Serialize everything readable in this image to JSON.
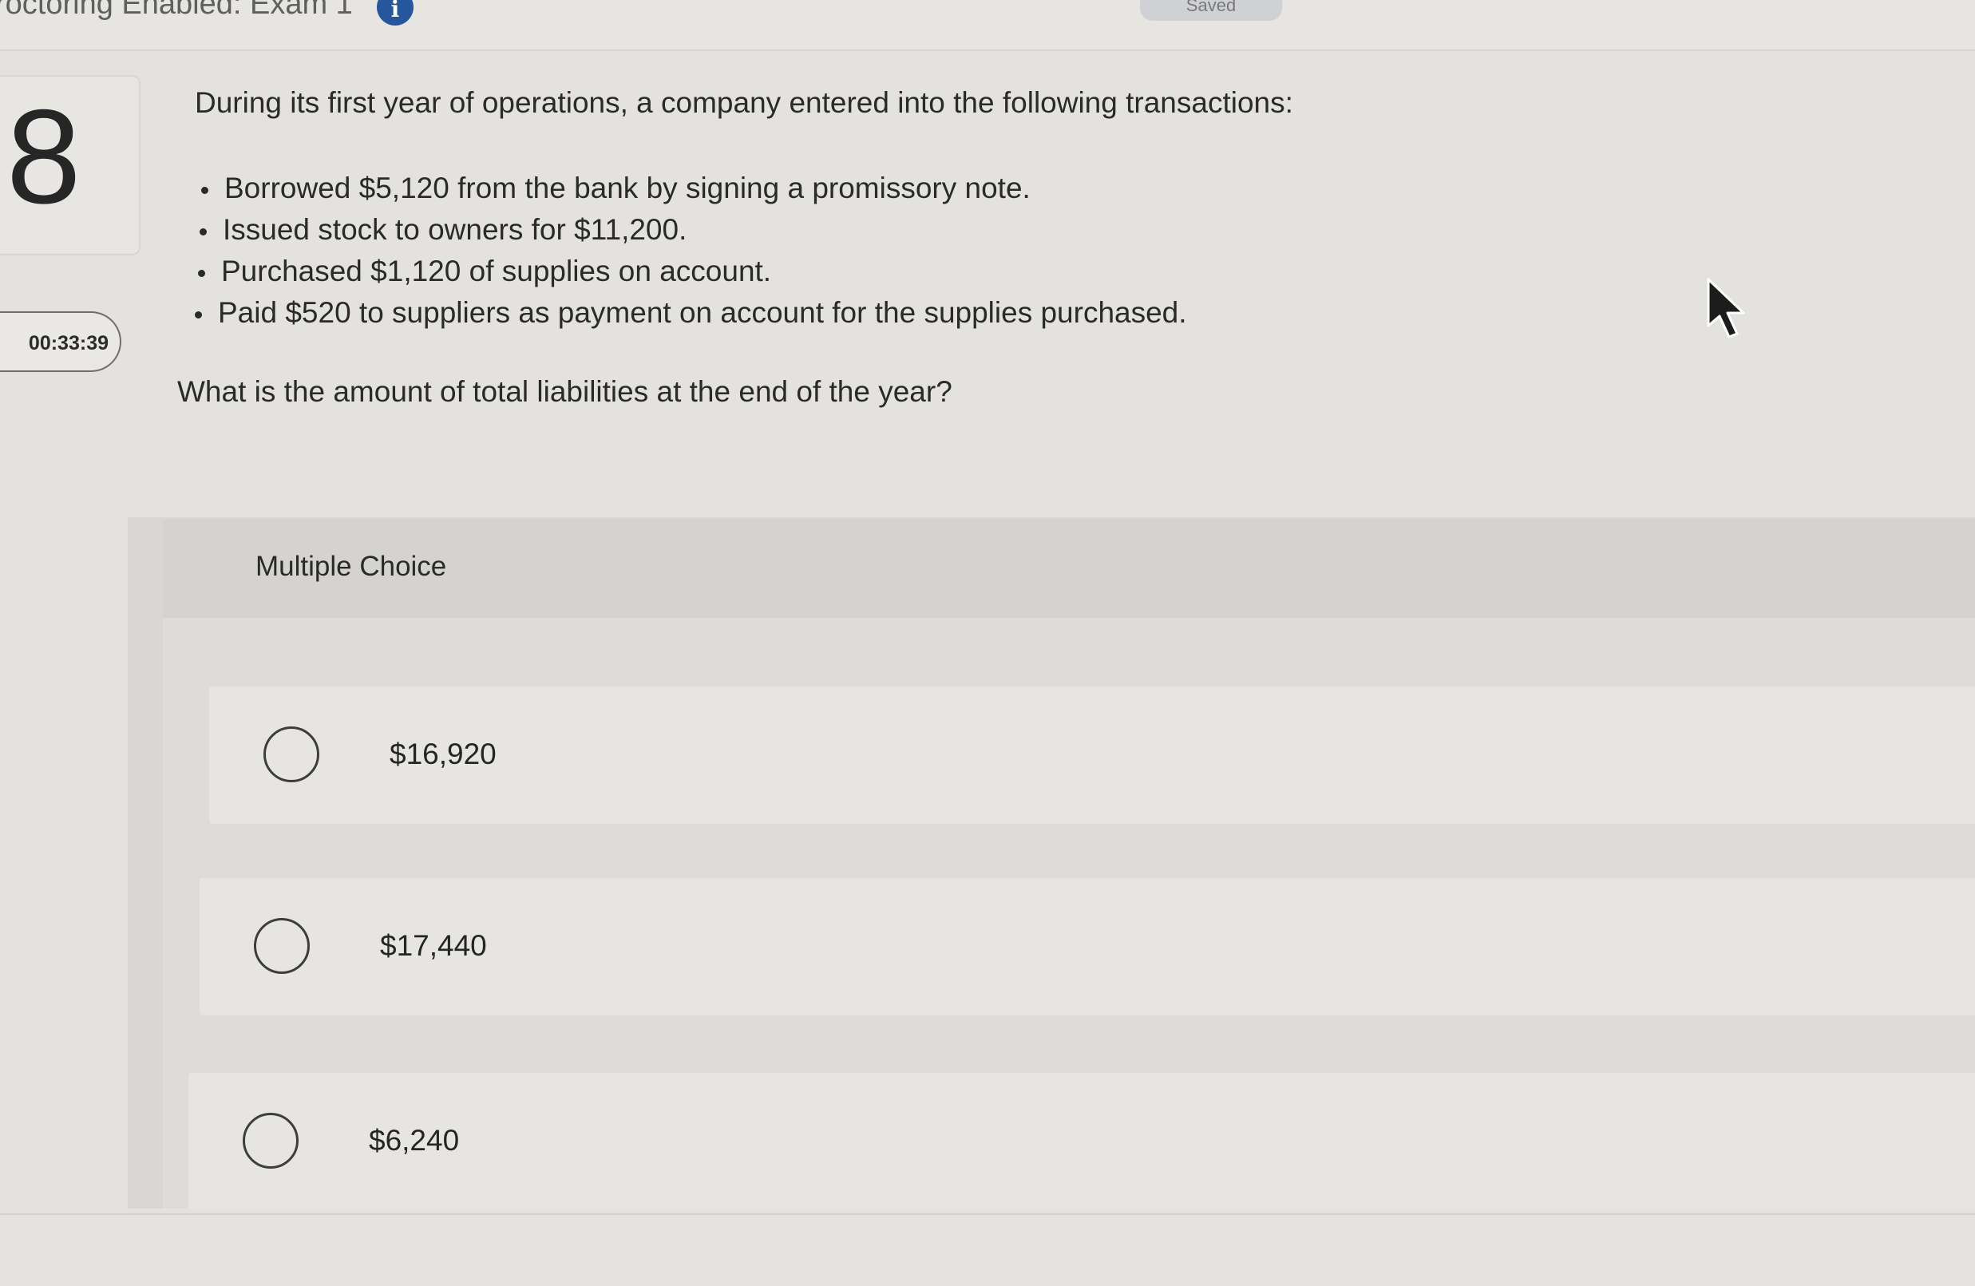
{
  "header": {
    "exam_title": "roctoring Enabled: Exam 1",
    "info_badge": "i",
    "saved_label": "Saved"
  },
  "question": {
    "number": "8",
    "timer": "00:33:39",
    "prompt": "During its first year of operations, a company entered into the following transactions:",
    "transactions": [
      "Borrowed $5,120 from the bank by signing a promissory note.",
      "Issued stock to owners for $11,200.",
      "Purchased $1,120 of supplies on account.",
      "Paid $520 to suppliers as payment on account for the supplies purchased."
    ],
    "text": "What is the amount of total liabilities at the end of the year?"
  },
  "multiple_choice": {
    "label": "Multiple Choice",
    "options": [
      {
        "label": "$16,920",
        "selected": false
      },
      {
        "label": "$17,440",
        "selected": false
      },
      {
        "label": "$6,240",
        "selected": false
      }
    ]
  },
  "icons": {
    "info": "info-icon",
    "cursor": "mouse-pointer-icon",
    "radio": "radio-button-icon"
  },
  "colors": {
    "page_bg": "#e3e2df",
    "info_badge": "#26579e",
    "text": "#2a2a2a"
  }
}
